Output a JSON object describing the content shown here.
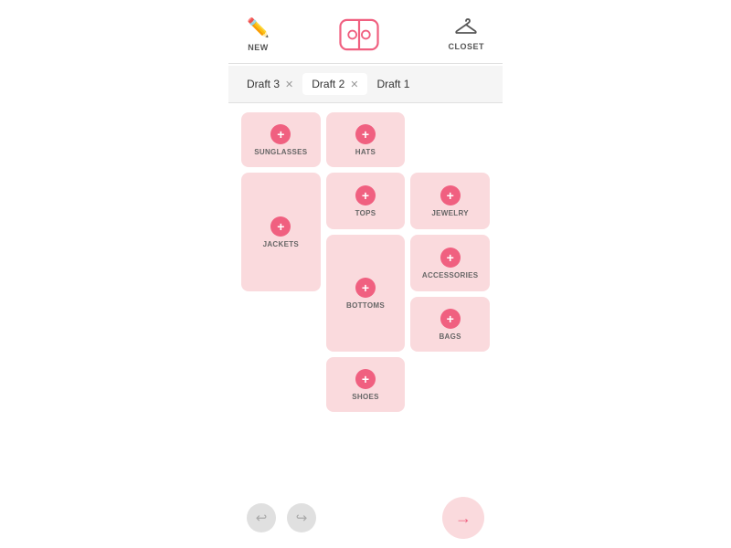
{
  "nav": {
    "new_label": "NEW",
    "closet_label": "CLOSET"
  },
  "tabs": [
    {
      "id": "draft3",
      "label": "Draft 3",
      "closable": true
    },
    {
      "id": "draft2",
      "label": "Draft 2",
      "closable": true,
      "active": true
    },
    {
      "id": "draft1",
      "label": "Draft 1",
      "closable": false
    }
  ],
  "categories": [
    {
      "id": "sunglasses",
      "label": "SUNGLASSES"
    },
    {
      "id": "hats",
      "label": "HATS"
    },
    {
      "id": "jackets",
      "label": "JACKETS"
    },
    {
      "id": "tops",
      "label": "TOPS"
    },
    {
      "id": "jewelry",
      "label": "JEWELRY"
    },
    {
      "id": "accessories",
      "label": "ACCESSORIES"
    },
    {
      "id": "bottoms",
      "label": "BOTTOMS"
    },
    {
      "id": "bags",
      "label": "BAGS"
    },
    {
      "id": "shoes",
      "label": "SHOES"
    }
  ],
  "controls": {
    "undo_icon": "↩",
    "redo_icon": "↪",
    "next_icon": "→"
  }
}
